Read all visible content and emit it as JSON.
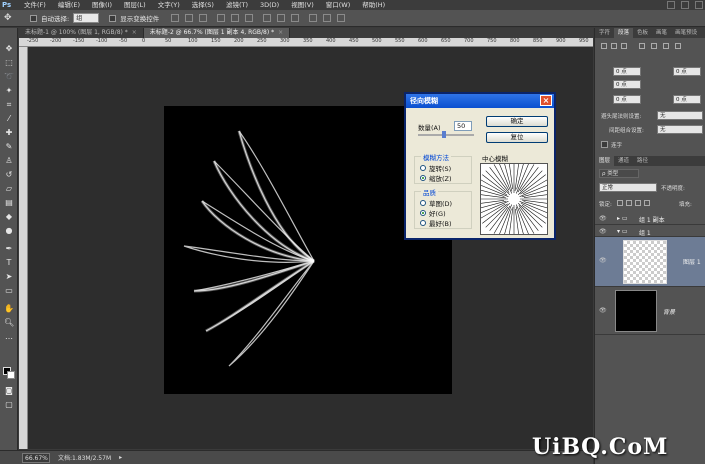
{
  "app": {
    "logo": "Ps"
  },
  "menu": [
    "文件(F)",
    "编辑(E)",
    "图像(I)",
    "图层(L)",
    "文字(Y)",
    "选择(S)",
    "滤镜(T)",
    "3D(D)",
    "视图(V)",
    "窗口(W)",
    "帮助(H)"
  ],
  "options": {
    "tool_icon": "✥",
    "auto_select_label": "自动选择:",
    "auto_select_value": "组",
    "show_transform_label": "显示变换控件"
  },
  "tabs": [
    {
      "label": "未标题-1 @ 100% (图层 1, RGB/8) *",
      "close": "×"
    },
    {
      "label": "未标题-2 @ 66.7% (图层 1 副本 4, RGB/8) *",
      "close": "×"
    }
  ],
  "ruler_ticks": [
    "-250",
    "-200",
    "-150",
    "-100",
    "-50",
    "0",
    "50",
    "100",
    "150",
    "200",
    "250",
    "300",
    "350",
    "400",
    "450",
    "500",
    "550",
    "600",
    "650",
    "700",
    "750",
    "800",
    "850",
    "900",
    "950"
  ],
  "status": {
    "zoom": "66.67%",
    "doc": "文档:1.83M/2.57M"
  },
  "dialog": {
    "title": "径向模糊",
    "close": "×",
    "amount_label": "数量(A)",
    "amount_value": "50",
    "ok": "确定",
    "reset": "复位",
    "method_title": "模糊方法",
    "method_spin": "旋转(S)",
    "method_zoom": "缩放(Z)",
    "method_selected": "zoom",
    "quality_title": "品质",
    "quality_draft": "草图(D)",
    "quality_good": "好(G)",
    "quality_best": "最好(B)",
    "quality_selected": "good",
    "center_title": "中心模糊"
  },
  "panels": {
    "top_tabs": [
      "字符",
      "段落",
      "色板",
      "画笔",
      "画笔预设"
    ],
    "pt_values": [
      "0 点",
      "0 点",
      "0 点",
      "0 点",
      "0 点"
    ],
    "hyphen_label": "避头尾法则设置:",
    "hyphen_value": "无",
    "spacing_label": "间距组合设置:",
    "spacing_value": "无",
    "hyphenate_label": "连字",
    "layer_tabs": [
      "图层",
      "通道",
      "路径"
    ],
    "kind_label": "ρ 类型",
    "blend_mode": "正常",
    "opacity_label": "不透明度:",
    "lock_label": "锁定:",
    "fill_label": "填充:",
    "layers": [
      {
        "name": "组 1 副本",
        "type": "group"
      },
      {
        "name": "组 1",
        "type": "group"
      },
      {
        "name": "图层 1",
        "type": "pixel"
      },
      {
        "name": "背景",
        "type": "background"
      }
    ]
  },
  "watermark": "UiBQ.CoM"
}
